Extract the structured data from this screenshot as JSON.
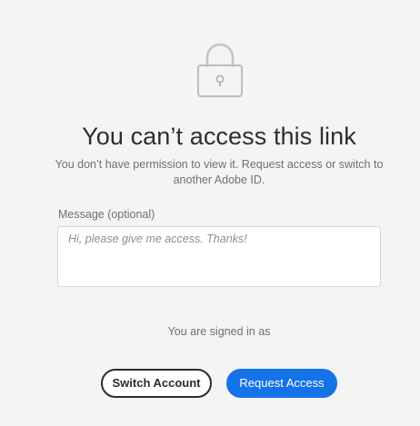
{
  "icon": "lock-icon",
  "colors": {
    "background": "#f4f4f4",
    "primary_button": "#1473e6",
    "secondary_border": "#2c2c2c",
    "muted_text": "#707070"
  },
  "header": {
    "title": "You can’t access this link",
    "subtitle": "You don’t have permission to view it. Request access or switch to another Adobe ID."
  },
  "message": {
    "label": "Message (optional)",
    "placeholder": "Hi, please give me access. Thanks!",
    "value": ""
  },
  "account": {
    "signed_in_text": "You are signed in as"
  },
  "actions": {
    "switch_label": "Switch Account",
    "request_label": "Request Access"
  }
}
